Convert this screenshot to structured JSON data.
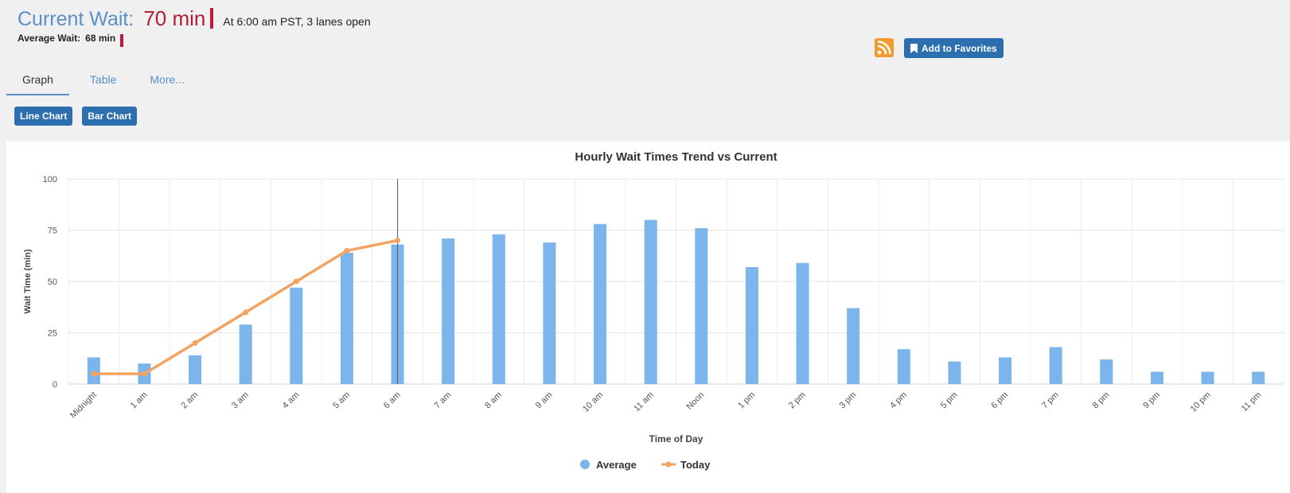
{
  "header": {
    "current_label": "Current Wait:",
    "current_value": "70 min",
    "note": "At 6:00 am PST, 3 lanes open",
    "average_label": "Average Wait:",
    "average_value": "68 min"
  },
  "actions": {
    "rss_icon": "rss-icon",
    "favorites_label": "Add to Favorites"
  },
  "tabs": [
    {
      "label": "Graph",
      "active": true
    },
    {
      "label": "Table",
      "active": false
    },
    {
      "label": "More...",
      "active": false
    }
  ],
  "chart_buttons": {
    "line": "Line Chart",
    "bar": "Bar Chart"
  },
  "colors": {
    "accent": "#2b6fae",
    "current": "#b02033",
    "average_bar": "#7cb5ec",
    "today_line": "#f4a460"
  },
  "chart_data": {
    "type": "bar",
    "title": "Hourly Wait Times Trend vs Current",
    "xlabel": "Time of Day",
    "ylabel": "Wait Time (min)",
    "ylim": [
      0,
      100
    ],
    "yticks": [
      0,
      25,
      50,
      75,
      100
    ],
    "categories": [
      "Midnight",
      "1 am",
      "2 am",
      "3 am",
      "4 am",
      "5 am",
      "6 am",
      "7 am",
      "8 am",
      "9 am",
      "10 am",
      "11 am",
      "Noon",
      "1 pm",
      "2 pm",
      "3 pm",
      "4 pm",
      "5 pm",
      "6 pm",
      "7 pm",
      "8 pm",
      "9 pm",
      "10 pm",
      "11 pm"
    ],
    "series": [
      {
        "name": "Average",
        "type": "bar",
        "values": [
          13,
          10,
          14,
          29,
          47,
          64,
          68,
          71,
          73,
          69,
          78,
          80,
          76,
          57,
          59,
          37,
          17,
          11,
          13,
          18,
          12,
          6,
          6,
          6
        ]
      },
      {
        "name": "Today",
        "type": "line",
        "values": [
          5,
          5,
          20,
          35,
          50,
          65,
          70
        ]
      }
    ],
    "current_index": 6,
    "grid": true,
    "legend": "bottom-center"
  }
}
